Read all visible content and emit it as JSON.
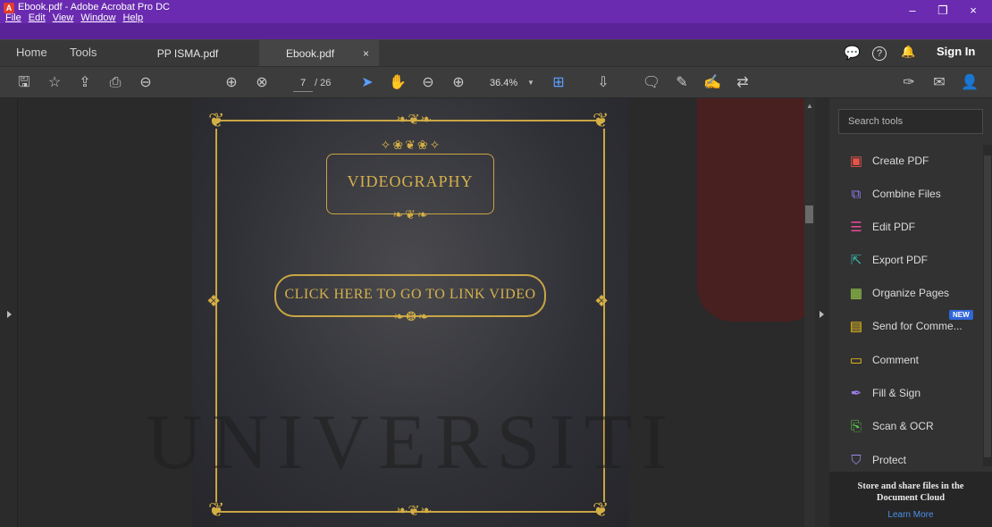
{
  "window": {
    "title": "Ebook.pdf - Adobe Acrobat Pro DC",
    "menus": [
      "File",
      "Edit",
      "View",
      "Window",
      "Help"
    ],
    "controls": {
      "minimize": "–",
      "maximize": "❐",
      "close": "×"
    }
  },
  "tabs": {
    "home": "Home",
    "tools": "Tools",
    "documents": [
      {
        "label": "PP ISMA.pdf",
        "active": false
      },
      {
        "label": "Ebook.pdf",
        "active": true
      }
    ],
    "close_glyph": "×",
    "sign_in": "Sign In"
  },
  "toolbar": {
    "current_page": "7",
    "total_pages": "/ 26",
    "zoom": "36.4%",
    "icons": [
      "save-icon",
      "bookmark-star-icon",
      "upload-cloud-icon",
      "print-icon",
      "zoom-search-icon",
      "page-up-icon",
      "page-down-icon",
      "select-cursor-icon",
      "hand-icon",
      "zoom-out-icon",
      "zoom-in-icon",
      "fit-page-icon",
      "scroll-mode-icon",
      "comment-icon",
      "highlight-pen-icon",
      "sign-icon",
      "more-tools-icon",
      "share-pen-icon",
      "mail-icon",
      "add-user-icon"
    ]
  },
  "document": {
    "title_text": "VIDEOGRAPHY",
    "link_text": "CLICK HERE TO GO TO LINK VIDEO",
    "watermark": "UNIVERSITI"
  },
  "tools_panel": {
    "search_placeholder": "Search tools",
    "items": [
      {
        "label": "Create PDF",
        "icon": "create-pdf-icon",
        "color": "#e8534a",
        "new": false
      },
      {
        "label": "Combine Files",
        "icon": "combine-files-icon",
        "color": "#8a7de8",
        "new": false
      },
      {
        "label": "Edit PDF",
        "icon": "edit-pdf-icon",
        "color": "#e84a9a",
        "new": false
      },
      {
        "label": "Export PDF",
        "icon": "export-pdf-icon",
        "color": "#3bb3a8",
        "new": false
      },
      {
        "label": "Organize Pages",
        "icon": "organize-pages-icon",
        "color": "#9ad24a",
        "new": false
      },
      {
        "label": "Send for Comme...",
        "icon": "send-comment-icon",
        "color": "#f0c419",
        "new": true
      },
      {
        "label": "Comment",
        "icon": "comment-tool-icon",
        "color": "#f0c419",
        "new": false
      },
      {
        "label": "Fill & Sign",
        "icon": "fill-sign-icon",
        "color": "#9a7de8",
        "new": false
      },
      {
        "label": "Scan & OCR",
        "icon": "scan-ocr-icon",
        "color": "#5ad24a",
        "new": false
      },
      {
        "label": "Protect",
        "icon": "protect-icon",
        "color": "#9a8ae8",
        "new": false
      }
    ],
    "new_badge": "NEW",
    "cloud_text": "Store and share files in the Document Cloud",
    "learn_more": "Learn More"
  }
}
